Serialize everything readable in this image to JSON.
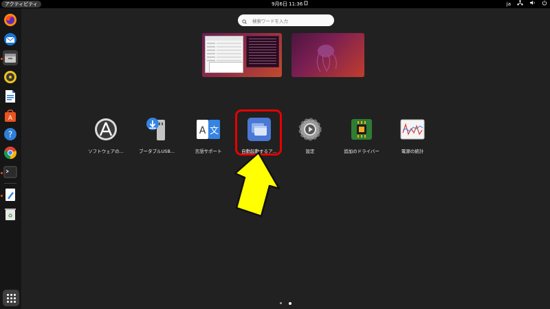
{
  "topbar": {
    "activities": "アクティビティ",
    "clock": "9月6日  11:36",
    "input_method": "ja",
    "network_icon": "network-icon",
    "volume_icon": "volume-icon",
    "power_icon": "power-icon"
  },
  "dock": {
    "items": [
      {
        "name": "firefox",
        "icon": "firefox-icon"
      },
      {
        "name": "thunderbird",
        "icon": "mail-icon"
      },
      {
        "name": "files",
        "icon": "folder-icon"
      },
      {
        "name": "rhythmbox",
        "icon": "music-icon"
      },
      {
        "name": "libreoffice-writer",
        "icon": "document-icon"
      },
      {
        "name": "ubuntu-software",
        "icon": "store-icon"
      },
      {
        "name": "help",
        "icon": "help-icon"
      },
      {
        "name": "chrome",
        "icon": "chrome-icon"
      },
      {
        "name": "terminal",
        "icon": "terminal-icon"
      },
      {
        "name": "text-editor",
        "icon": "editor-icon"
      },
      {
        "name": "trash",
        "icon": "trash-icon"
      }
    ],
    "show_apps": "show-apps-icon"
  },
  "search": {
    "placeholder": "検索ワードを入力"
  },
  "apps": [
    {
      "label": "ソフトウェアの...",
      "icon": "software-updater-icon"
    },
    {
      "label": "ブータブルUSB...",
      "icon": "usb-creator-icon"
    },
    {
      "label": "言語サポート",
      "icon": "language-support-icon"
    },
    {
      "label": "自動起動するア...",
      "icon": "startup-apps-icon"
    },
    {
      "label": "設定",
      "icon": "settings-icon"
    },
    {
      "label": "追加のドライバー",
      "icon": "drivers-icon"
    },
    {
      "label": "電源の統計",
      "icon": "power-stats-icon"
    }
  ],
  "colors": {
    "accent": "#e95420",
    "highlight": "#e80000",
    "arrow": "#ffff00"
  }
}
